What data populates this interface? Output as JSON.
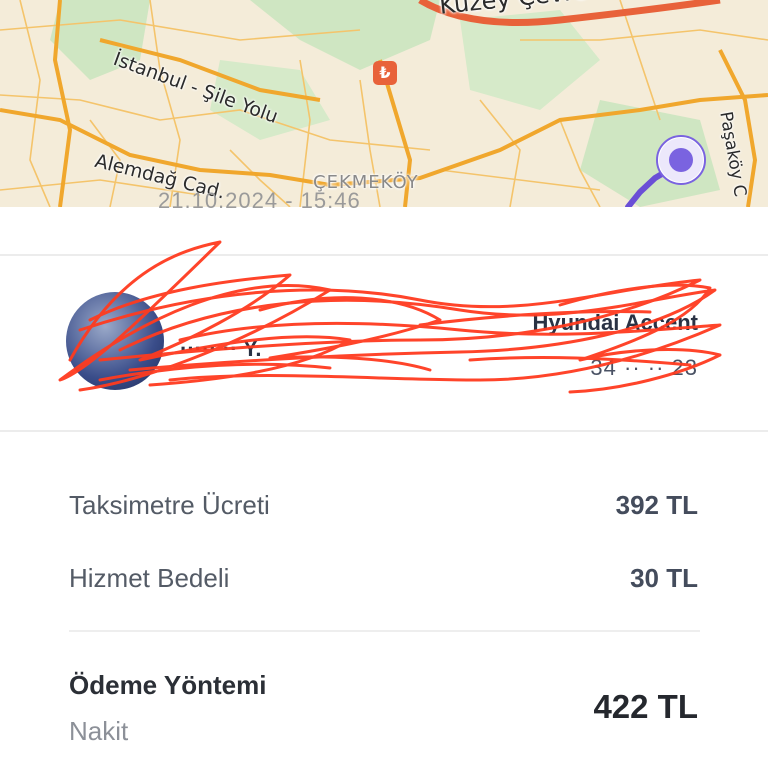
{
  "map": {
    "labels": {
      "highway": "Kuzey Çevre Otoyolu",
      "road_sile": "İstanbul - Şile Yolu",
      "alemdag": "Alemdağ Cad.",
      "district": "ÇEKMEKÖY",
      "pasakoy": "Paşaköy C",
      "lira_icon": "₺"
    },
    "colors": {
      "land": "#f4ecd9",
      "green": "#cfe6c2",
      "road_major": "#f0a72d",
      "road_minor": "#f4c46b",
      "highway": "#e8623a",
      "route": "#6a4fd6",
      "marker": "#7a63e0"
    }
  },
  "trip": {
    "date_time": "21.10.2024 - 15:46"
  },
  "driver": {
    "vehicle": "Hyundai Accent",
    "plate": "34 ·· ·· 23",
    "name": "·····  ·· Y."
  },
  "fare": {
    "items": [
      {
        "label": "Taksimetre Ücreti",
        "value": "392 TL"
      },
      {
        "label": "Hizmet Bedeli",
        "value": "30 TL"
      }
    ],
    "payment_label": "Ödeme Yöntemi",
    "payment_method": "Nakit",
    "total": "422 TL"
  },
  "redaction": {
    "color": "#ff3b1f"
  }
}
